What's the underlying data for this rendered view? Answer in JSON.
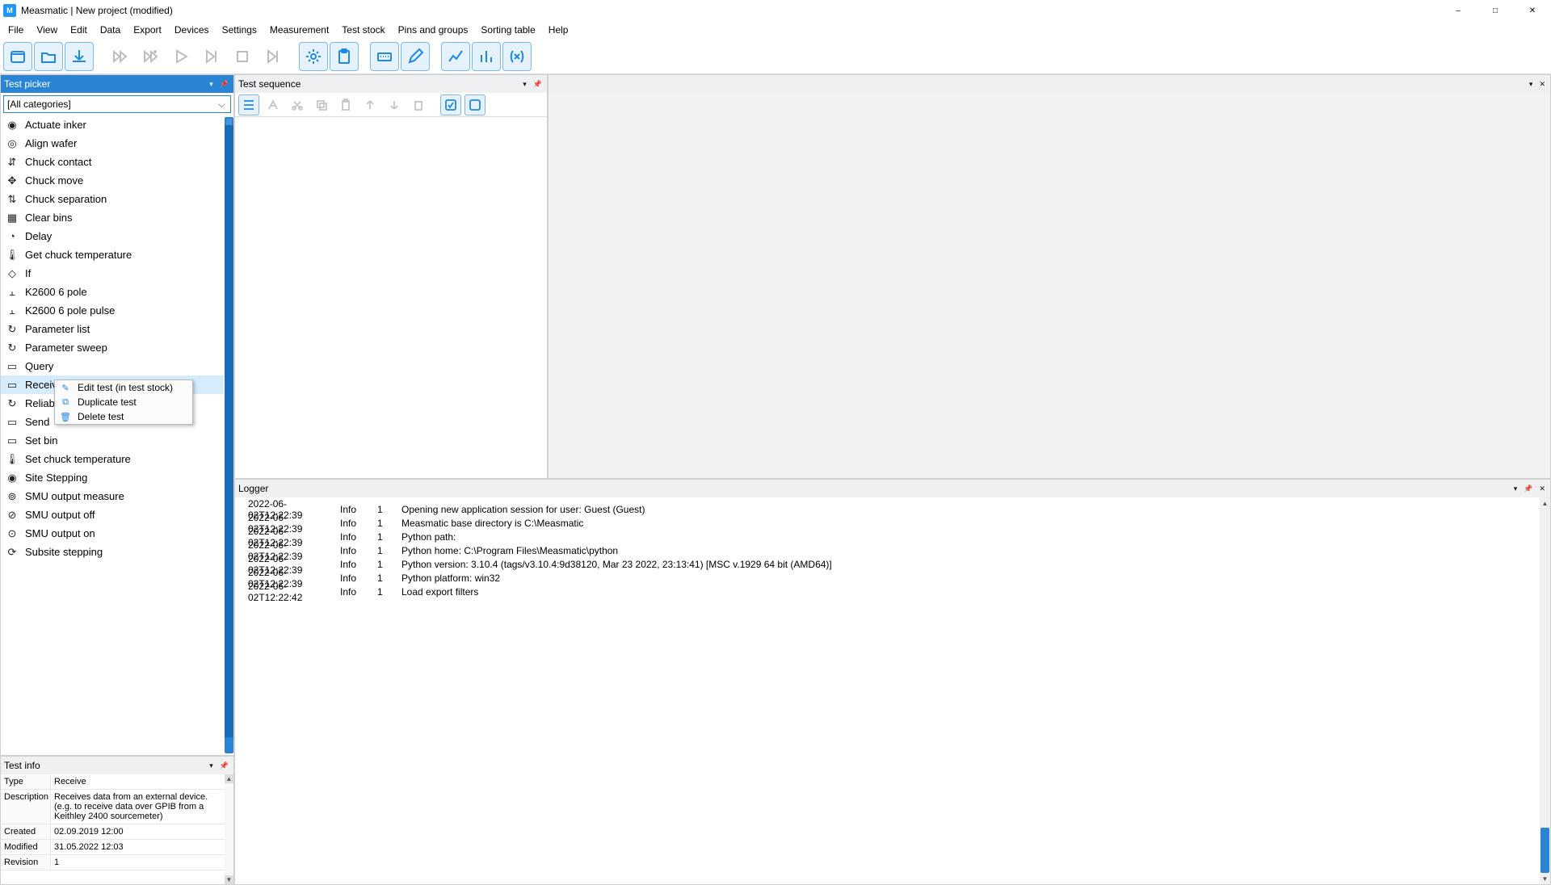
{
  "window": {
    "app_badge": "M",
    "title": "Measmatic | New project (modified)"
  },
  "menu": [
    "File",
    "View",
    "Edit",
    "Data",
    "Export",
    "Devices",
    "Settings",
    "Measurement",
    "Test stock",
    "Pins and groups",
    "Sorting table",
    "Help"
  ],
  "left_panel": {
    "title": "Test picker",
    "combo": "[All categories]",
    "items": [
      "Actuate inker",
      "Align wafer",
      "Chuck contact",
      "Chuck move",
      "Chuck separation",
      "Clear bins",
      "Delay",
      "Get chuck temperature",
      "If",
      "K2600 6 pole",
      "K2600 6 pole pulse",
      "Parameter list",
      "Parameter sweep",
      "Query",
      "Receive",
      "Reliab",
      "Send",
      "Set bin",
      "Set chuck temperature",
      "Site Stepping",
      "SMU output measure",
      "SMU output off",
      "SMU output on",
      "Subsite stepping"
    ],
    "highlight_index": 14,
    "context_menu": [
      "Edit test (in test stock)",
      "Duplicate test",
      "Delete test"
    ]
  },
  "seq_panel": {
    "title": "Test sequence"
  },
  "right_panel": {
    "title": ""
  },
  "info_panel": {
    "title": "Test info",
    "rows": [
      {
        "k": "Type",
        "v": "Receive"
      },
      {
        "k": "Description",
        "v": "Receives data from an external device. (e.g. to receive data over GPIB from a Keithley 2400 sourcemeter)"
      },
      {
        "k": "Created",
        "v": "02.09.2019 12:00"
      },
      {
        "k": "Modified",
        "v": "31.05.2022 12:03"
      },
      {
        "k": "Revision",
        "v": "1"
      }
    ]
  },
  "logger": {
    "title": "Logger",
    "rows": [
      {
        "t": "2022-06-02T12:22:39",
        "lvl": "Info",
        "n": "1",
        "msg": "Opening new application session for user: Guest (Guest)"
      },
      {
        "t": "2022-06-02T12:22:39",
        "lvl": "Info",
        "n": "1",
        "msg": "Measmatic base directory is C:\\Measmatic"
      },
      {
        "t": "2022-06-02T12:22:39",
        "lvl": "Info",
        "n": "1",
        "msg": "Python path:"
      },
      {
        "t": "2022-06-02T12:22:39",
        "lvl": "Info",
        "n": "1",
        "msg": "Python home: C:\\Program Files\\Measmatic\\python"
      },
      {
        "t": "2022-06-02T12:22:39",
        "lvl": "Info",
        "n": "1",
        "msg": "Python version: 3.10.4 (tags/v3.10.4:9d38120, Mar 23 2022, 23:13:41) [MSC v.1929 64 bit (AMD64)]"
      },
      {
        "t": "2022-06-02T12:22:39",
        "lvl": "Info",
        "n": "1",
        "msg": "Python platform: win32"
      },
      {
        "t": "2022-06-02T12:22:42",
        "lvl": "Info",
        "n": "1",
        "msg": "Load export filters"
      }
    ]
  }
}
